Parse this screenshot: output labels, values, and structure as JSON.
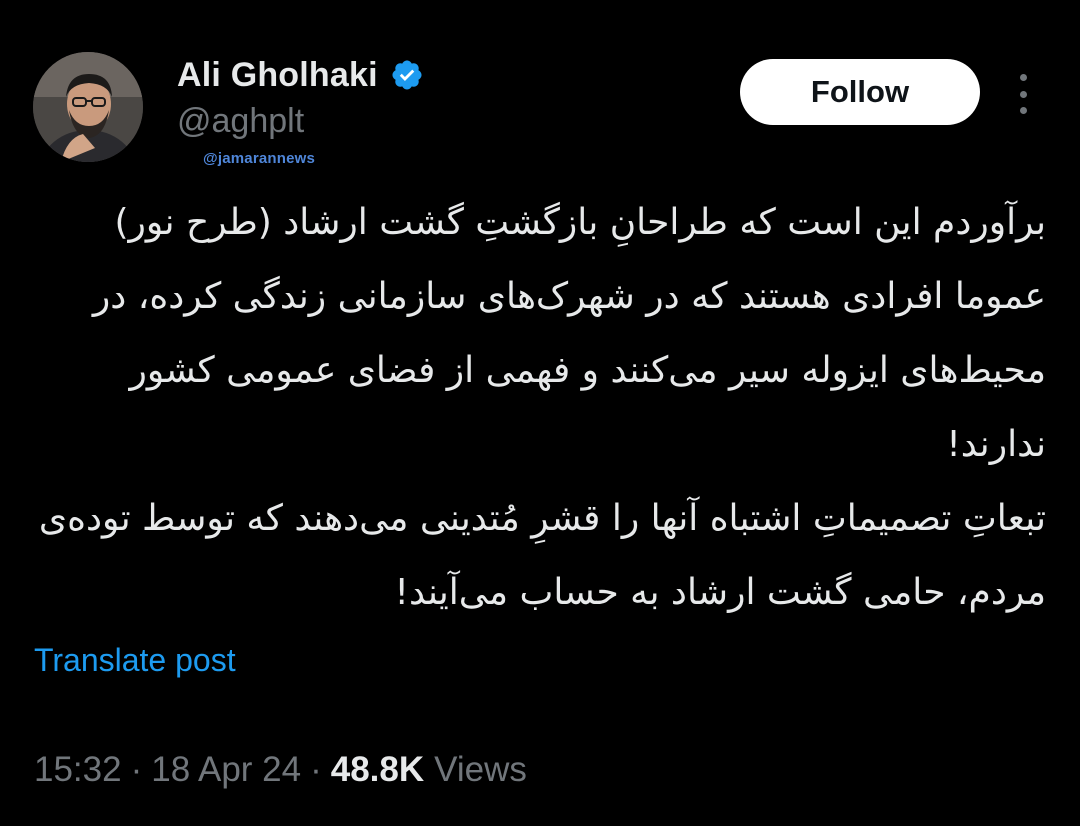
{
  "author": {
    "display_name": "Ali Gholhaki",
    "handle": "@aghplt",
    "verified": true,
    "avatar_icon": "profile-photo"
  },
  "watermark": "@jamarannews",
  "follow_label": "Follow",
  "more_icon": "more-vertical-icon",
  "tweet": {
    "text": "برآوردم این است که طراحانِ بازگشتِ گشت ارشاد (طرح نور) عموما افرادی هستند که در شهرک‌های سازمانی زندگی کرده، در محیط‌های ایزوله سیر می‌کنند و فهمی از فضای عمومی کشور ندارند!\nتبعاتِ تصمیماتِ اشتباه آنها را قشرِ مُتدینی می‌دهند که توسط توده‌ی مردم، حامی گشت ارشاد به حساب می‌آیند!"
  },
  "translate_label": "Translate post",
  "meta": {
    "time": "15:32",
    "separator": "·",
    "date": "18 Apr 24",
    "views_count": "48.8K",
    "views_label": "Views"
  },
  "colors": {
    "background": "#000000",
    "text": "#e7e9ea",
    "muted": "#71767b",
    "link": "#1d9bf0",
    "verified": "#1d9bf0",
    "watermark": "#4f86d9"
  }
}
